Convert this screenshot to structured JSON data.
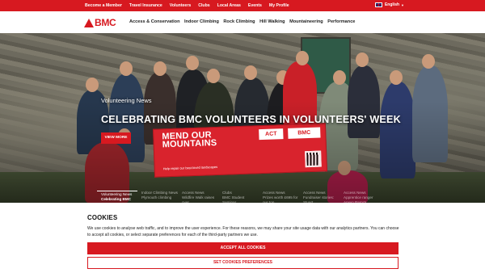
{
  "topbar": {
    "links": [
      "Become a Member",
      "Travel Insurance",
      "Volunteers",
      "Clubs",
      "Local Areas",
      "Events",
      "My Profile"
    ],
    "language": "English"
  },
  "nav": {
    "logo": "BMC",
    "items": [
      "Access & Conservation",
      "Indoor Climbing",
      "Rock Climbing",
      "Hill Walking",
      "Mountaineering",
      "Performance"
    ]
  },
  "hero": {
    "kicker": "Volunteering News",
    "headline": "CELEBRATING BMC VOLUNTEERS IN VOLUNTEERS' WEEK",
    "cta": "VIEW MORE",
    "banner": {
      "main": "MEND OUR MOUNTAINS",
      "sub": "Help repair our best-loved landscapes",
      "badge1": "ACT",
      "badge2": "BMC"
    }
  },
  "slides": [
    {
      "category": "Volunteering News",
      "title": "Celebrating BMC",
      "active": true
    },
    {
      "category": "Indoor Climbing News",
      "title": "Plymouth climbing",
      "active": false
    },
    {
      "category": "Access News",
      "title": "Wildfire Walk raises over",
      "active": false
    },
    {
      "category": "Clubs",
      "title": "BMC Student Seminar",
      "active": false
    },
    {
      "category": "Access News",
      "title": "Prizes worth £695 for our top",
      "active": false
    },
    {
      "category": "Access News",
      "title": "Fundraiser stories: Stuart",
      "active": false
    },
    {
      "category": "Access News",
      "title": "Apprentice ranger Arwyn Parry's",
      "active": false
    }
  ],
  "cookies": {
    "title": "COOKIES",
    "body": "We use cookies to analyse web traffic, and to improve the user experience. For these reasons, we may share your site usage data with our analytics partners. You can choose to accept all cookies, or select separate preferences for each of the third-party partners we use.",
    "accept": "ACCEPT ALL COOKIES",
    "settings": "SET COOKIES PREFERENCES"
  },
  "colors": {
    "brand_red": "#d71920"
  }
}
